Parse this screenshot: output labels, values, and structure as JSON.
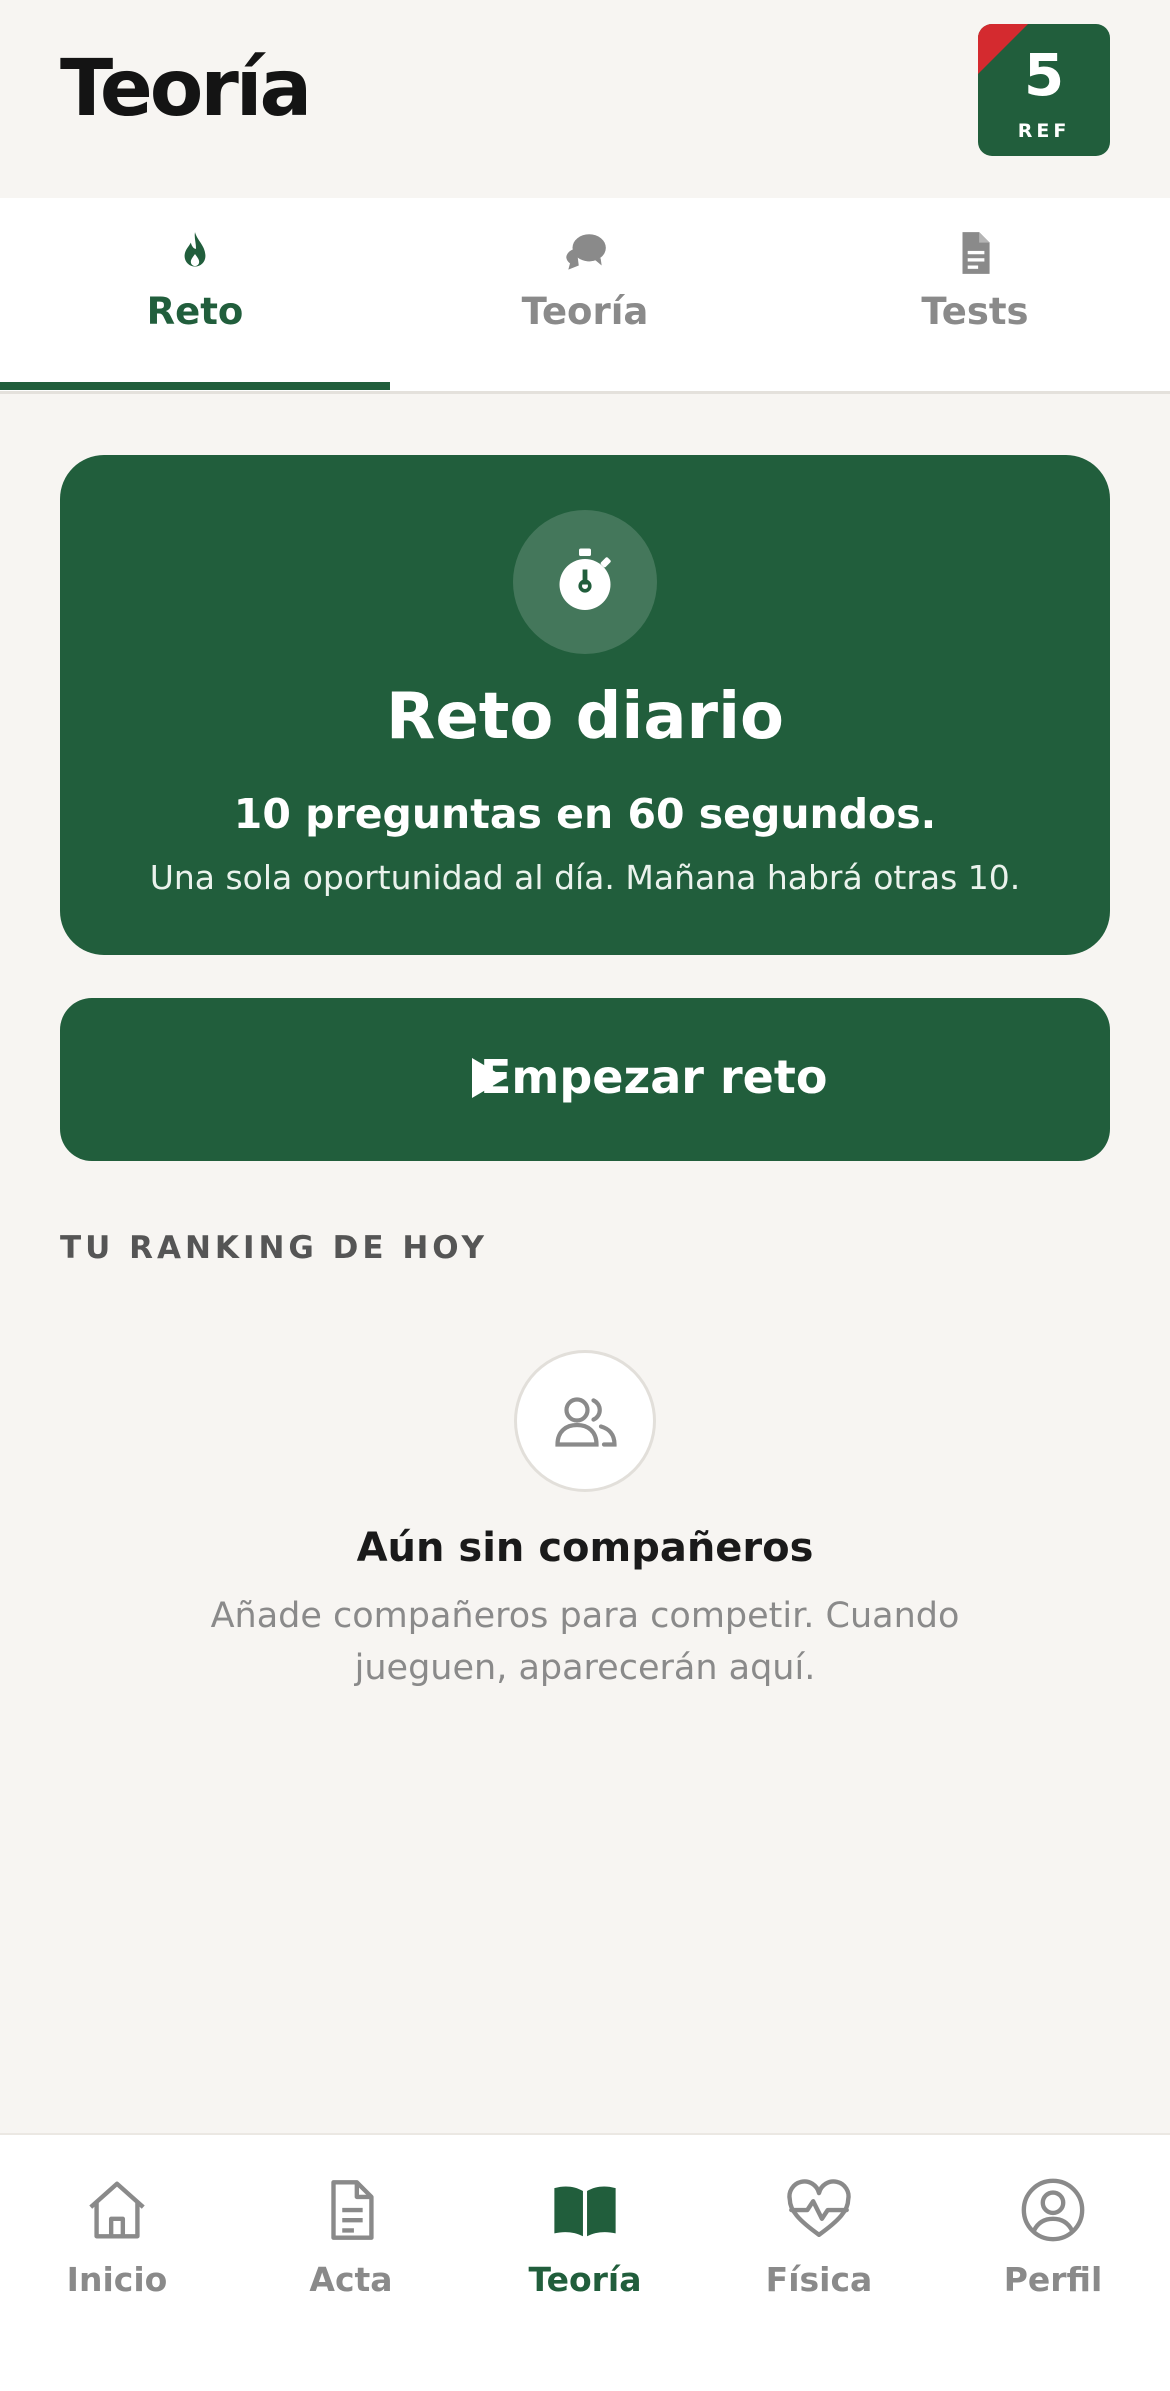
{
  "header": {
    "title": "Teoría",
    "badge_number": "5",
    "badge_label": "REF"
  },
  "tabs": [
    {
      "label": "Reto",
      "icon": "flame-icon",
      "active": true
    },
    {
      "label": "Teoría",
      "icon": "chat-bubbles-icon",
      "active": false
    },
    {
      "label": "Tests",
      "icon": "document-icon",
      "active": false
    }
  ],
  "challenge": {
    "icon": "stopwatch-icon",
    "title": "Reto diario",
    "subtitle": "10 preguntas en 60 segundos.",
    "description": "Una sola oportunidad al día. Mañana habrá otras 10."
  },
  "start_button": {
    "label": "Empezar reto",
    "icon": "play-icon"
  },
  "ranking": {
    "section_title": "TU RANKING DE HOY",
    "empty_icon": "users-icon",
    "empty_title": "Aún sin compañeros",
    "empty_description": "Añade compañeros para competir. Cuando jueguen, aparecerán aquí."
  },
  "bottom_nav": [
    {
      "label": "Inicio",
      "icon": "home-icon",
      "active": false
    },
    {
      "label": "Acta",
      "icon": "file-icon",
      "active": false
    },
    {
      "label": "Teoría",
      "icon": "book-icon",
      "active": true
    },
    {
      "label": "Física",
      "icon": "heart-pulse-icon",
      "active": false
    },
    {
      "label": "Perfil",
      "icon": "user-circle-icon",
      "active": false
    }
  ],
  "colors": {
    "primary": "#215e3c",
    "accent_red": "#d42a2f",
    "background": "#f7f5f2",
    "muted": "#8a8a8a"
  }
}
